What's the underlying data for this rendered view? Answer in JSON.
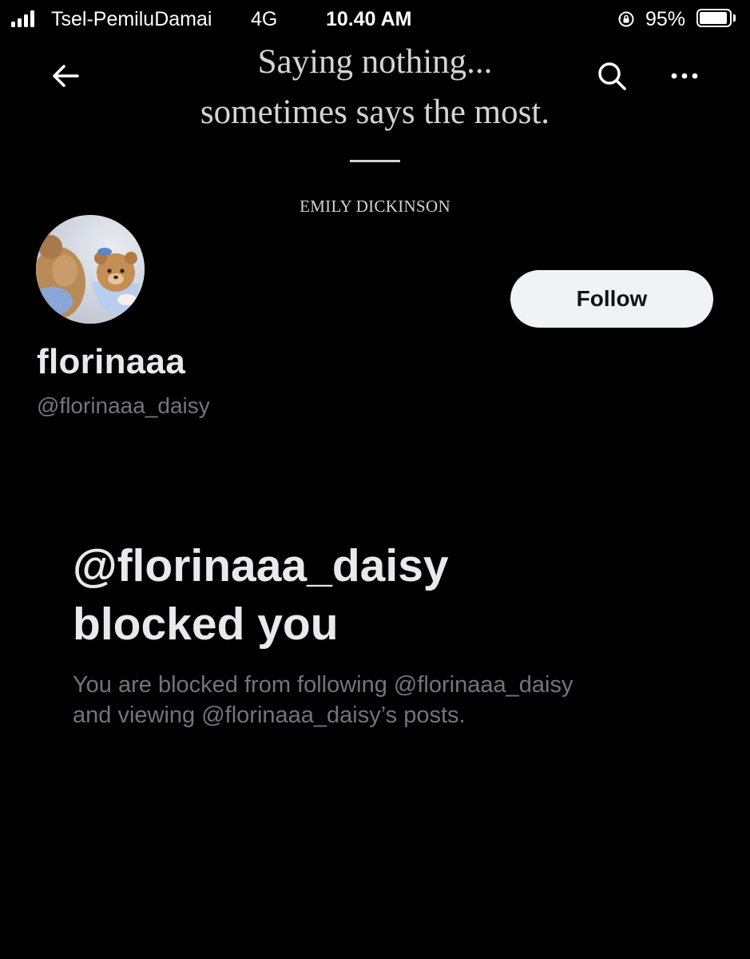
{
  "status_bar": {
    "carrier": "Tsel-PemiluDamai",
    "network": "4G",
    "time": "10.40 AM",
    "battery_percent": "95%",
    "battery_level": 0.95,
    "signal_bars": 4
  },
  "header": {
    "quote_line_1": "Saying nothing...",
    "quote_line_2": "sometimes says the most.",
    "quote_author": "EMILY DICKINSON",
    "icons": {
      "back": "back-arrow-icon",
      "search": "search-icon",
      "more": "more-options-icon"
    }
  },
  "profile": {
    "display_name": "florinaaa",
    "handle": "@florinaaa_daisy",
    "follow_label": "Follow",
    "avatar_icon": "avatar-teddy-bear-photo"
  },
  "blocked_notice": {
    "title_line_1": "@florinaaa_daisy",
    "title_line_2": "blocked you",
    "description_line_1": "You are blocked from following @florinaaa_daisy",
    "description_line_2": "and viewing @florinaaa_daisy’s posts."
  },
  "colors": {
    "background": "#000000",
    "primary_text": "#e7e9ea",
    "secondary_text": "#71767b",
    "follow_button_bg": "#eff3f4",
    "follow_button_text": "#0f1419"
  }
}
